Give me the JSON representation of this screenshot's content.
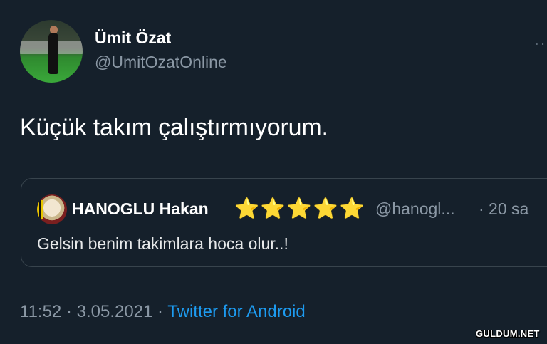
{
  "author": {
    "name": "Ümit Özat",
    "handle": "@UmitOzatOnline"
  },
  "more_icon": "more-dots-icon",
  "tweet": {
    "text": "Küçük takım çalıştırmıyorum."
  },
  "quote": {
    "author_name": "HANOGLU Hakan",
    "stars": "⭐⭐⭐⭐⭐",
    "handle": "@hanogl...",
    "time": "· 20 sa",
    "text": "Gelsin benim takimlara hoca olur..!"
  },
  "meta": {
    "time": "11:52",
    "separator1": " · ",
    "date": "3.05.2021",
    "separator2": " · ",
    "source": "Twitter for Android"
  },
  "watermark": "GULDUM.NET",
  "colors": {
    "background": "#15202b",
    "secondary_text": "#8b98a5",
    "link": "#1d9bf0",
    "border": "#38444d"
  }
}
